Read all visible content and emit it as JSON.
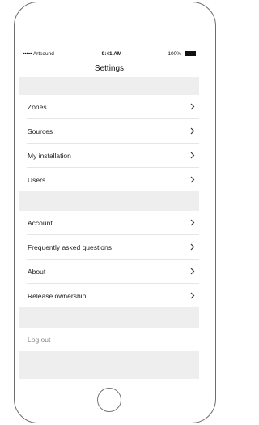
{
  "statusbar": {
    "carrier": "••••• Artsound",
    "time": "9:41 AM",
    "battery": "100%"
  },
  "nav": {
    "title": "Settings"
  },
  "group1": [
    "Zones",
    "Sources",
    "My installation",
    "Users"
  ],
  "group2": [
    "Account",
    "Frequently asked questions",
    "About",
    "Release ownership"
  ],
  "logout": {
    "label": "Log out"
  },
  "colors": {
    "background": "#ffffff",
    "group_gap": "#eeeeee",
    "separator": "#e6e6e6",
    "logout_text": "#8a8a8a"
  }
}
